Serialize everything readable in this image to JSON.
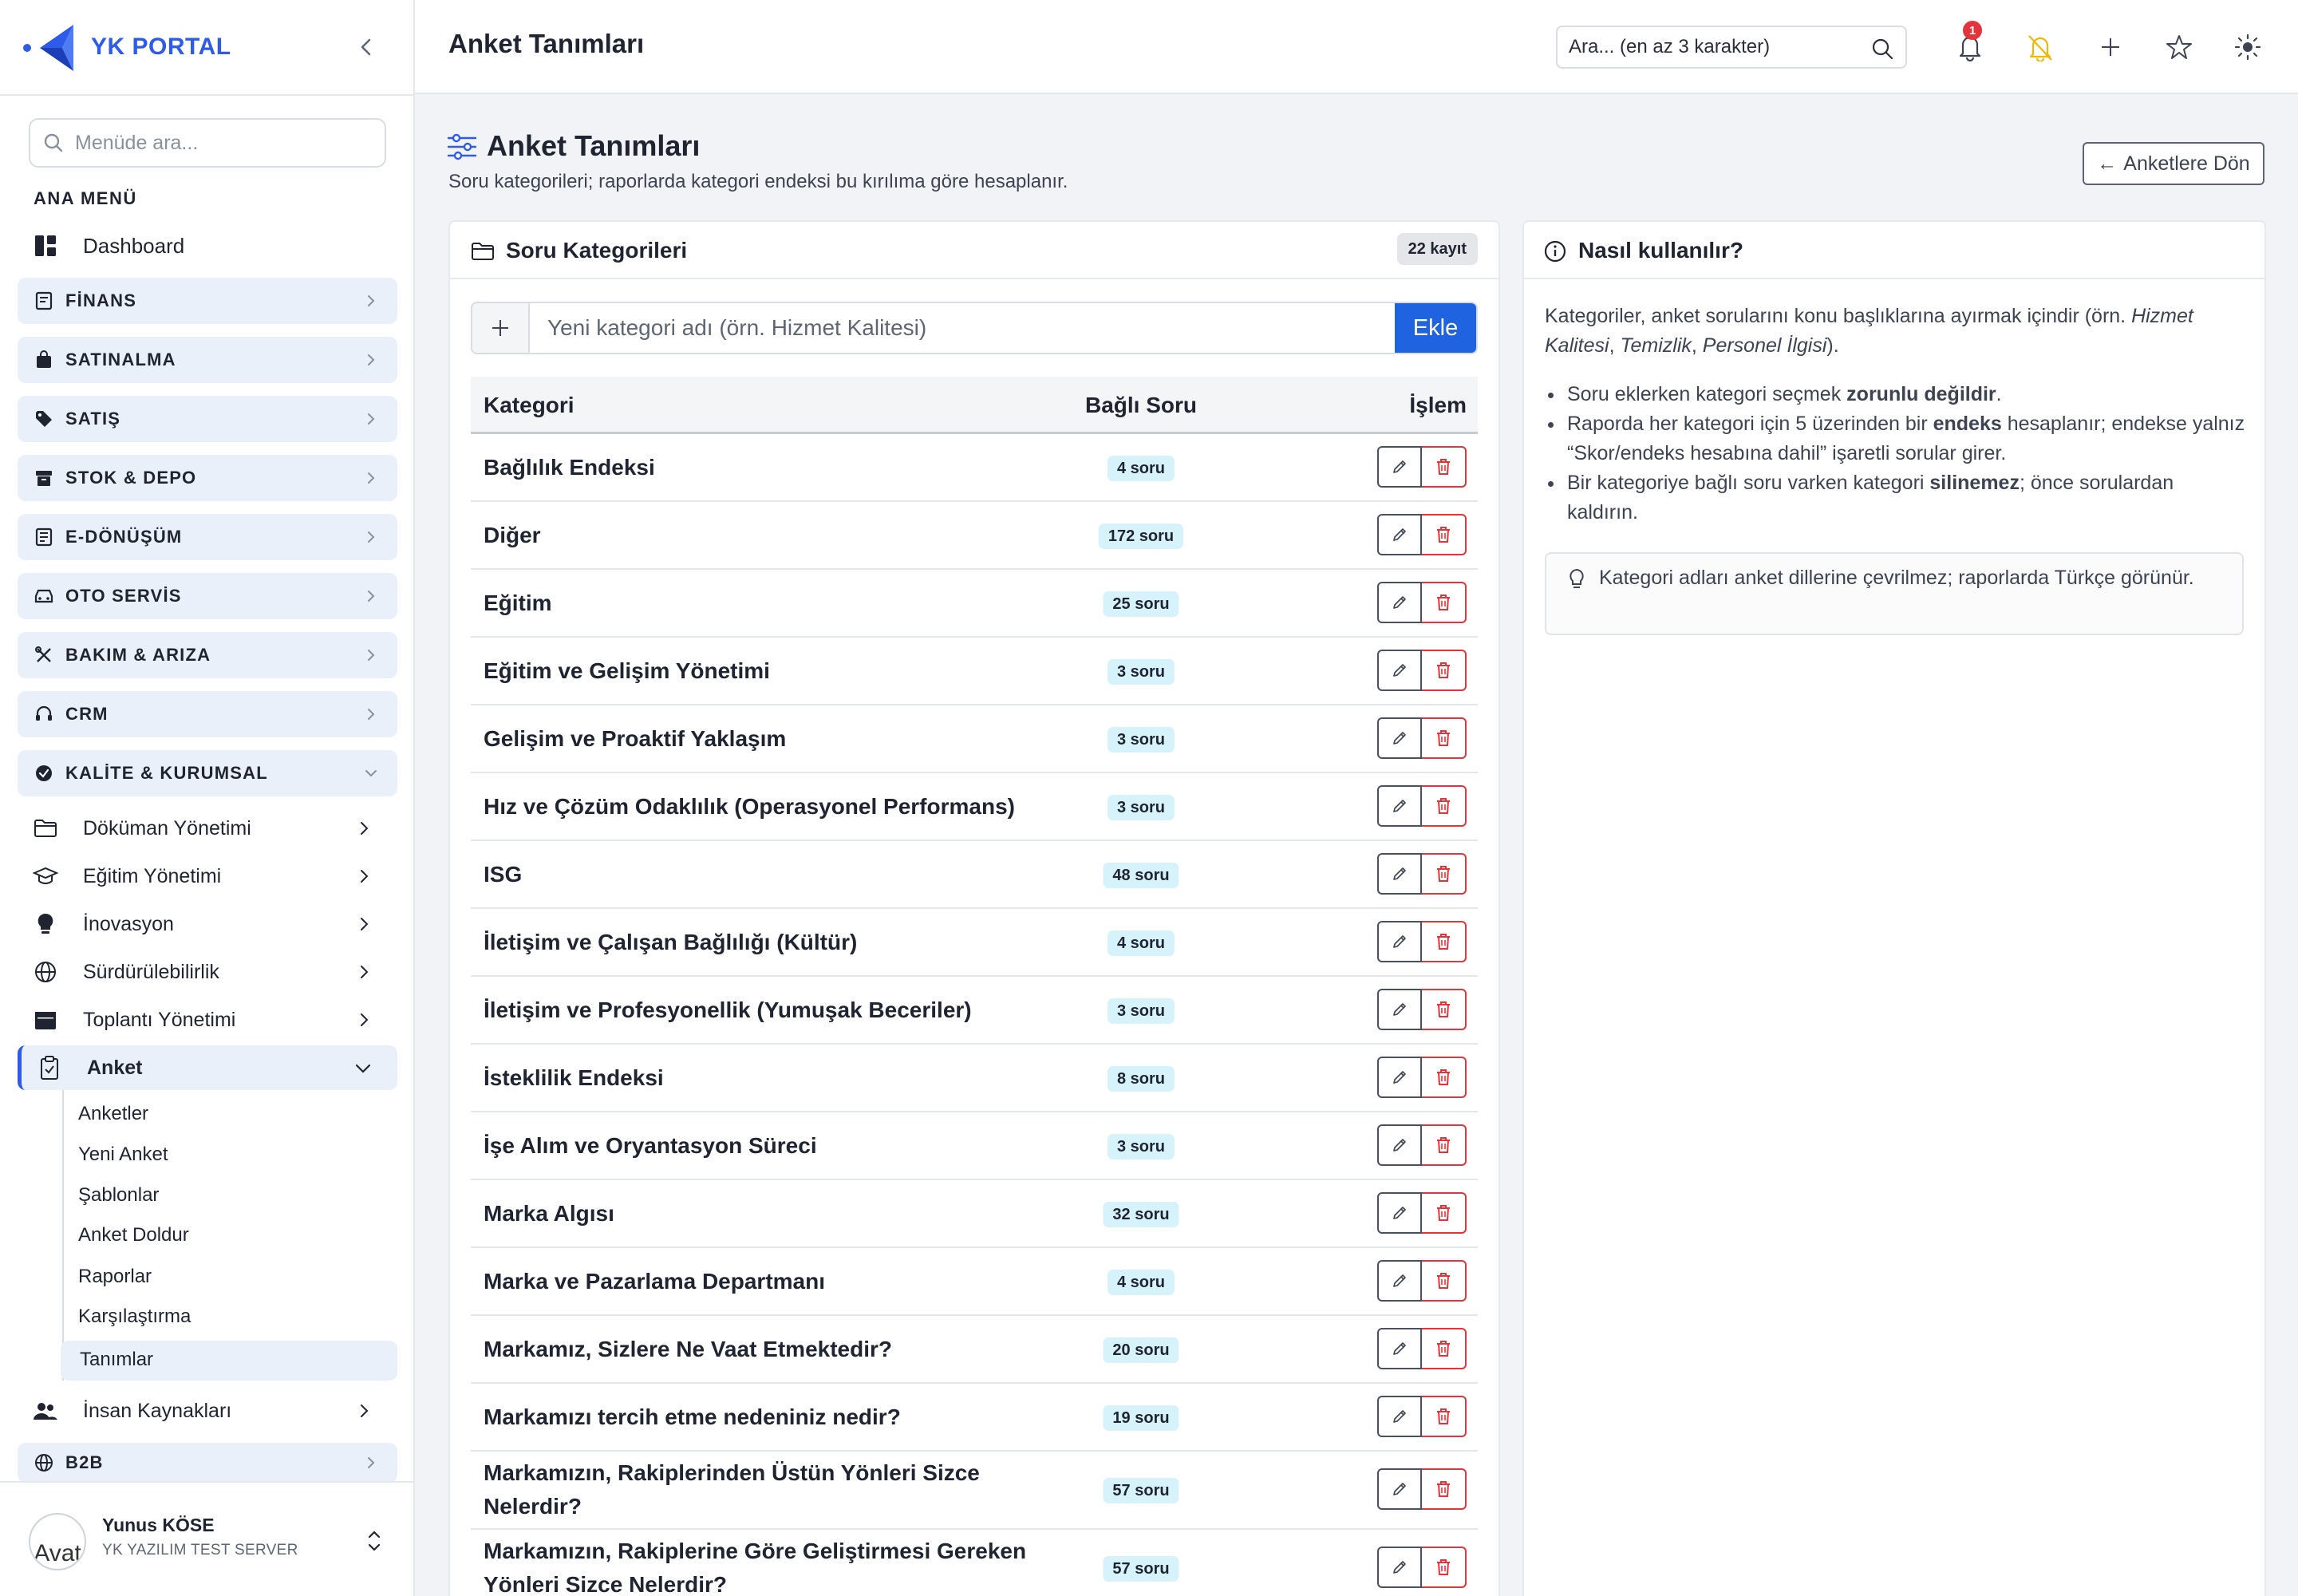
{
  "app": {
    "name": "YK PORTAL"
  },
  "sidebar": {
    "search_placeholder": "Menüde ara...",
    "section_title": "ANA MENÜ",
    "dashboard": "Dashboard",
    "groups": [
      {
        "label": "FİNANS",
        "icon": "receipt-icon"
      },
      {
        "label": "SATINALMA",
        "icon": "bag-icon"
      },
      {
        "label": "SATIŞ",
        "icon": "tag-icon"
      },
      {
        "label": "STOK & DEPO",
        "icon": "box-icon"
      },
      {
        "label": "E-DÖNÜŞÜM",
        "icon": "document-icon"
      },
      {
        "label": "OTO SERVİS",
        "icon": "car-icon"
      },
      {
        "label": "BAKIM & ARIZA",
        "icon": "tools-icon"
      },
      {
        "label": "CRM",
        "icon": "headset-icon"
      },
      {
        "label": "KALİTE & KURUMSAL",
        "icon": "shield-check-icon"
      }
    ],
    "kalite_items": [
      {
        "label": "Döküman Yönetimi",
        "icon": "folder-icon"
      },
      {
        "label": "Eğitim Yönetimi",
        "icon": "graduation-cap-icon"
      },
      {
        "label": "İnovasyon",
        "icon": "lightbulb-icon"
      },
      {
        "label": "Sürdürülebilirlik",
        "icon": "globe-icon"
      },
      {
        "label": "Toplantı Yönetimi",
        "icon": "calendar-icon"
      },
      {
        "label": "Anket",
        "icon": "clipboard-icon"
      }
    ],
    "anket_items": [
      "Anketler",
      "Yeni Anket",
      "Şablonlar",
      "Anket Doldur",
      "Raporlar",
      "Karşılaştırma",
      "Tanımlar"
    ],
    "after_items": [
      {
        "label": "İnsan Kaynakları",
        "icon": "users-icon"
      }
    ],
    "b2b": "B2B",
    "user": {
      "name": "Yunus KÖSE",
      "org": "YK YAZILIM TEST SERVER",
      "avatar_alt": "Avat"
    }
  },
  "topbar": {
    "title": "Anket Tanımları",
    "search_placeholder": "Ara... (en az 3 karakter)",
    "notification_count": "1"
  },
  "page": {
    "title": "Anket Tanımları",
    "subtitle": "Soru kategorileri; raporlarda kategori endeksi bu kırılıma göre hesaplanır.",
    "back_button": "Anketlere Dön"
  },
  "categories_card": {
    "title": "Soru Kategorileri",
    "count_badge": "22 kayıt",
    "input_placeholder": "Yeni kategori adı (örn. Hizmet Kalitesi)",
    "add_button": "Ekle",
    "columns": [
      "Kategori",
      "Bağlı Soru",
      "İşlem"
    ],
    "rows": [
      {
        "name": "Bağlılık Endeksi",
        "count": "4 soru"
      },
      {
        "name": "Diğer",
        "count": "172 soru"
      },
      {
        "name": "Eğitim",
        "count": "25 soru"
      },
      {
        "name": "Eğitim ve Gelişim Yönetimi",
        "count": "3 soru"
      },
      {
        "name": "Gelişim ve Proaktif Yaklaşım",
        "count": "3 soru"
      },
      {
        "name": "Hız ve Çözüm Odaklılık (Operasyonel Performans)",
        "count": "3 soru"
      },
      {
        "name": "ISG",
        "count": "48 soru"
      },
      {
        "name": "İletişim ve Çalışan Bağlılığı (Kültür)",
        "count": "4 soru"
      },
      {
        "name": "İletişim ve Profesyonellik (Yumuşak Beceriler)",
        "count": "3 soru"
      },
      {
        "name": "İsteklilik Endeksi",
        "count": "8 soru"
      },
      {
        "name": "İşe Alım ve Oryantasyon Süreci",
        "count": "3 soru"
      },
      {
        "name": "Marka Algısı",
        "count": "32 soru"
      },
      {
        "name": "Marka ve Pazarlama Departmanı",
        "count": "4 soru"
      },
      {
        "name": "Markamız, Sizlere Ne Vaat Etmektedir?",
        "count": "20 soru"
      },
      {
        "name": "Markamızı tercih etme nedeniniz nedir?",
        "count": "19 soru"
      },
      {
        "name": "Markamızın, Rakiplerinden Üstün Yönleri Sizce Nelerdir?",
        "count": "57 soru"
      },
      {
        "name": "Markamızın, Rakiplerine Göre Geliştirmesi Gereken Yönleri Sizce Nelerdir?",
        "count": "57 soru"
      }
    ]
  },
  "help_card": {
    "title": "Nasıl kullanılır?",
    "intro_a": "Kategoriler, anket sorularını konu başlıklarına ayırmak içindir (örn. ",
    "intro_ex1": "Hizmet Kalitesi",
    "intro_sep1": ", ",
    "intro_ex2": "Temizlik",
    "intro_sep2": ", ",
    "intro_ex3": "Personel İlgisi",
    "intro_end": ").",
    "b1_a": "Soru eklerken kategori seçmek ",
    "b1_b": "zorunlu değildir",
    "b1_c": ".",
    "b2_a": "Raporda her kategori için 5 üzerinden bir ",
    "b2_b": "endeks",
    "b2_c": " hesaplanır; endekse yalnız “Skor/endeks hesabına dahil” işaretli sorular girer.",
    "b3_a": "Bir kategoriye bağlı soru varken kategori ",
    "b3_b": "silinemez",
    "b3_c": "; önce sorulardan kaldırın.",
    "tip": "Kategori adları anket dillerine çevrilmez; raporlarda Türkçe görünür."
  },
  "colors": {
    "brand": "#2f5bea",
    "primary_button": "#1f63e0",
    "danger": "#e5323b",
    "badge_bg": "#d6f3fb",
    "warning_icon": "#f2b705"
  }
}
